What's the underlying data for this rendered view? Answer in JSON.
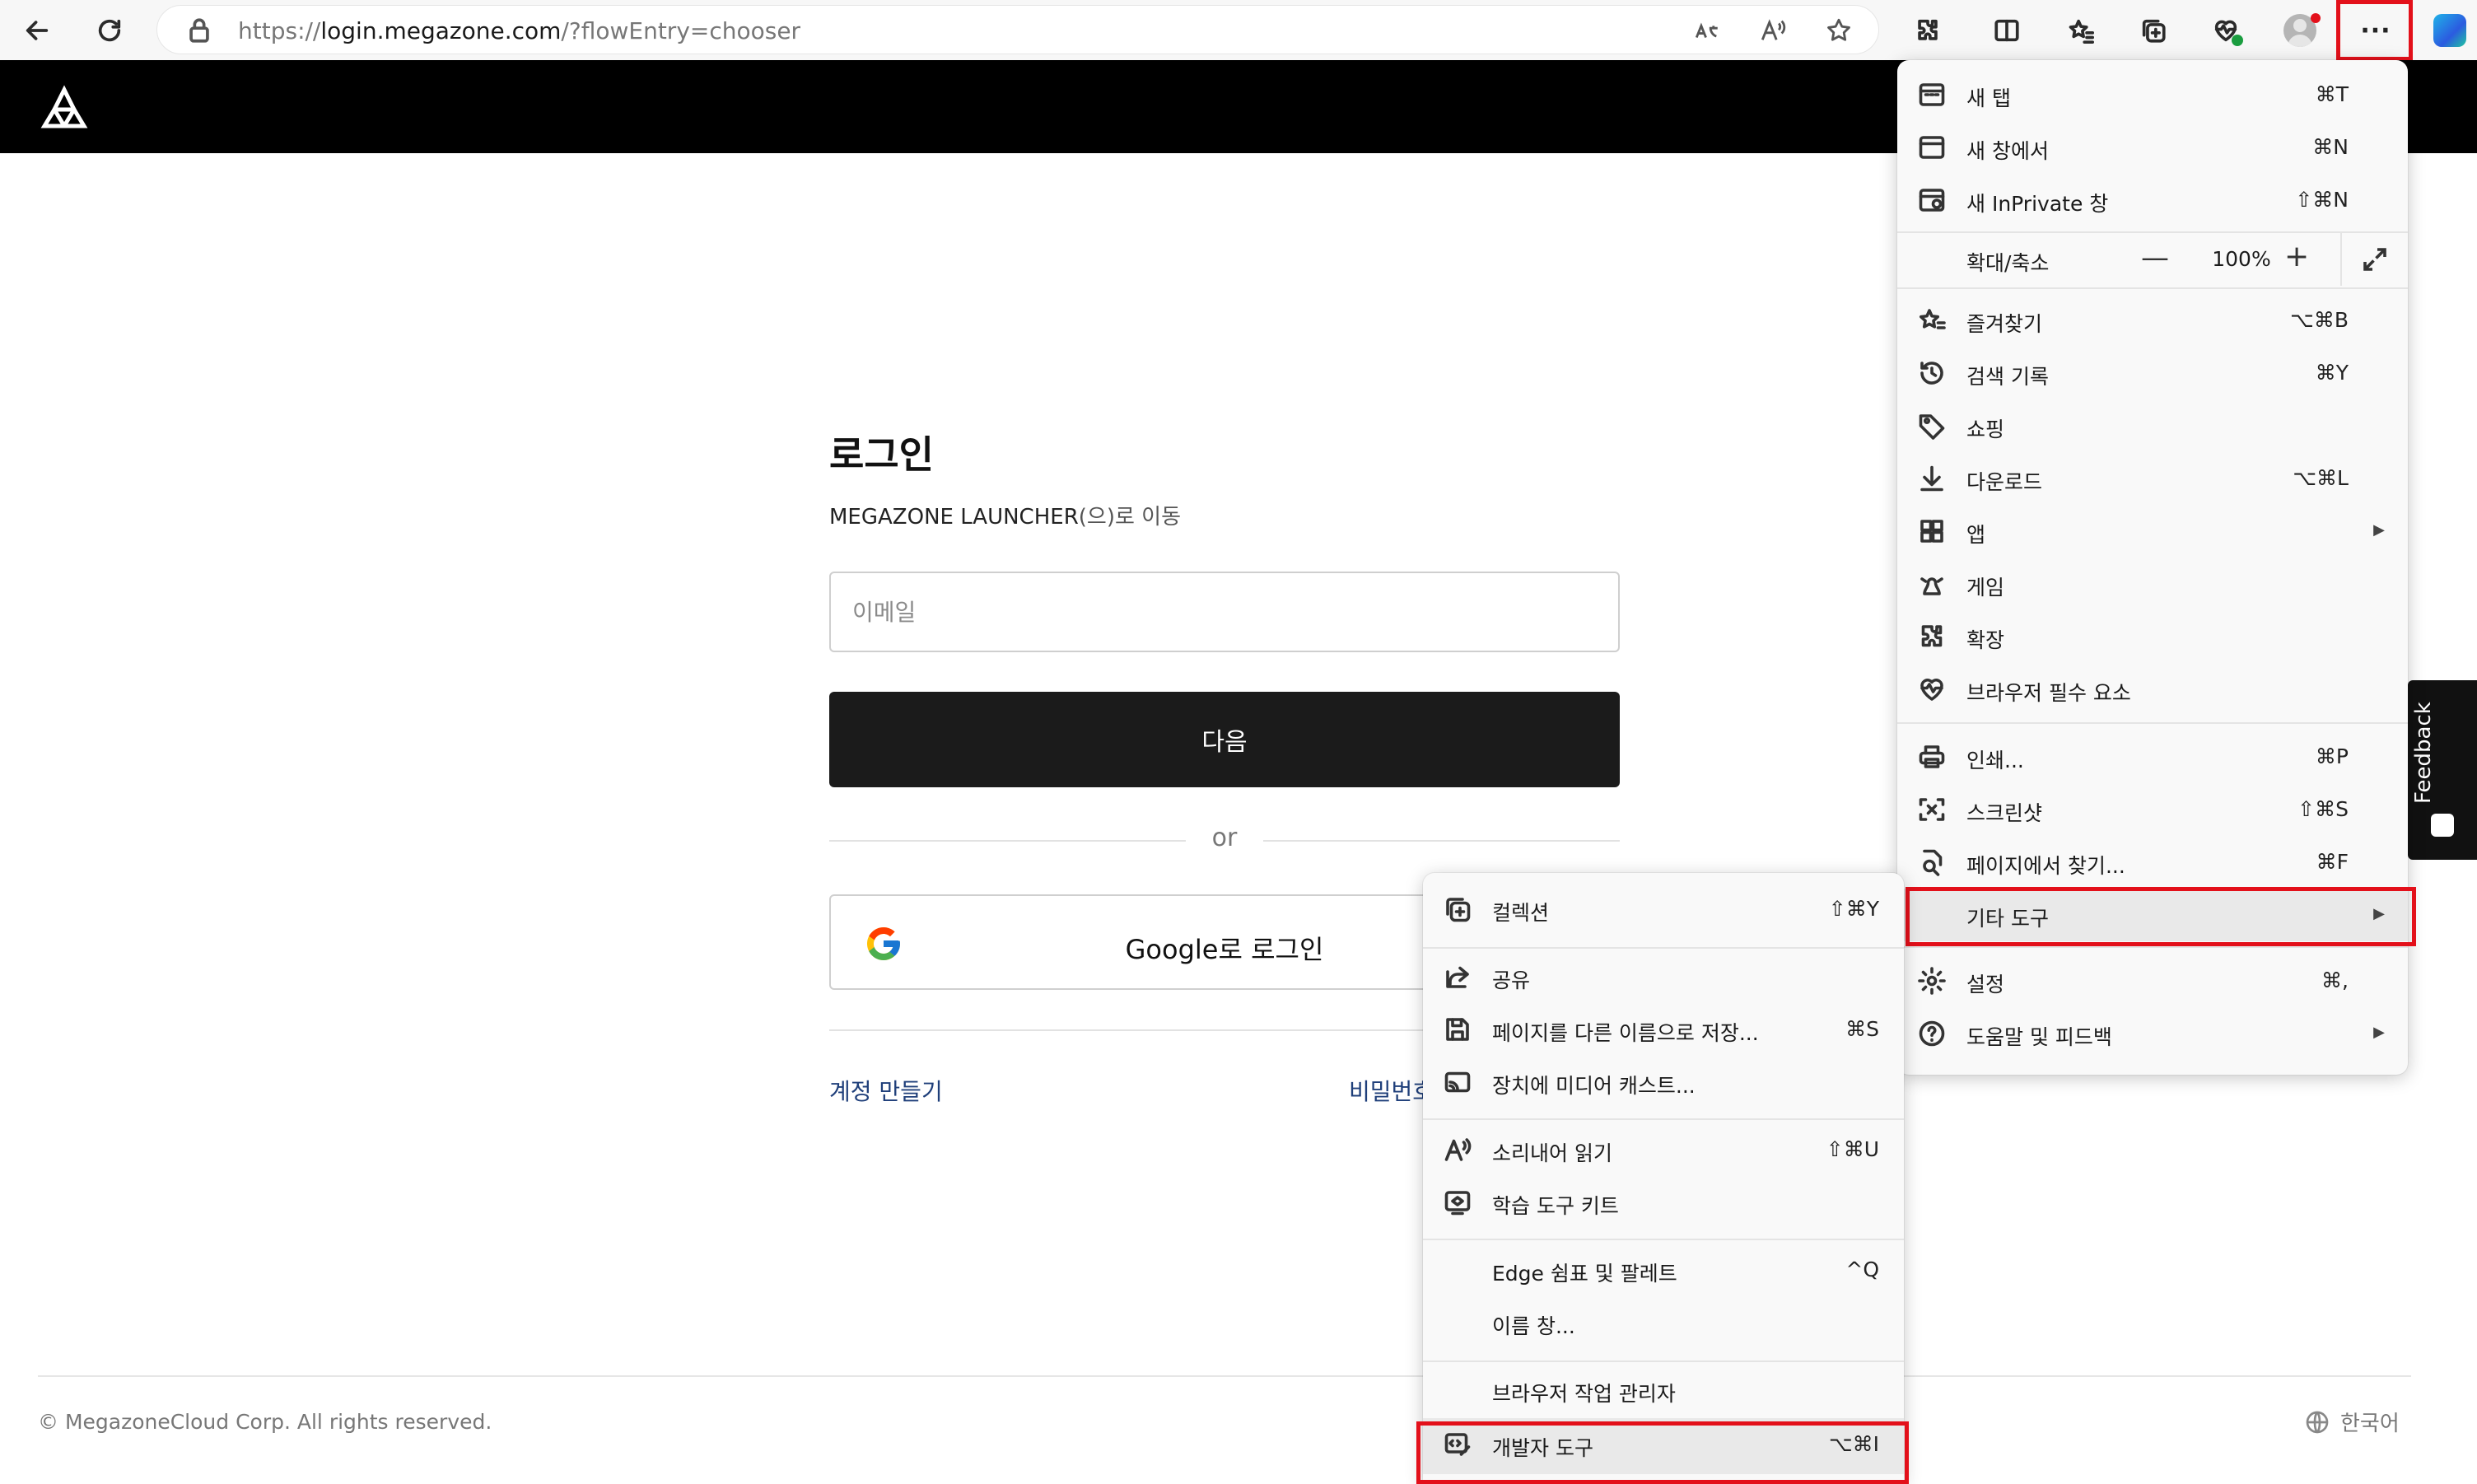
{
  "browser": {
    "url_prefix": "https://",
    "url_domain": "login.megazone.com",
    "url_path": "/?flowEntry=chooser",
    "more_glyph": "···"
  },
  "page": {
    "title": "로그인",
    "subtitle_app": "MEGAZONE LAUNCHER",
    "subtitle_move": "(으)로 이동",
    "email_placeholder": "이메일",
    "next_button": "다음",
    "or_text": "or",
    "google_button": "Google로 로그인",
    "create_account": "계정 만들기",
    "forgot_password": "비밀번호",
    "copyright": "© MegazoneCloud Corp. All rights reserved.",
    "language": "한국어",
    "feedback": "Feedback"
  },
  "main_menu": {
    "items": [
      {
        "label": "새 탭",
        "shortcut": "⌘T"
      },
      {
        "label": "새 창에서",
        "shortcut": "⌘N"
      },
      {
        "label": "새 InPrivate 창",
        "shortcut": "⇧⌘N"
      }
    ],
    "zoom": {
      "label": "확대/축소",
      "minus": "—",
      "value": "100%",
      "plus": "+"
    },
    "items2": [
      {
        "label": "즐겨찾기",
        "shortcut": "⌥⌘B"
      },
      {
        "label": "검색 기록",
        "shortcut": "⌘Y"
      },
      {
        "label": "쇼핑",
        "shortcut": ""
      },
      {
        "label": "다운로드",
        "shortcut": "⌥⌘L"
      },
      {
        "label": "앱",
        "shortcut": ""
      },
      {
        "label": "게임",
        "shortcut": ""
      },
      {
        "label": "확장",
        "shortcut": ""
      },
      {
        "label": "브라우저 필수 요소",
        "shortcut": ""
      }
    ],
    "items3": [
      {
        "label": "인쇄...",
        "shortcut": "⌘P"
      },
      {
        "label": "스크린샷",
        "shortcut": "⇧⌘S"
      },
      {
        "label": "페이지에서 찾기...",
        "shortcut": "⌘F"
      },
      {
        "label": "기타 도구",
        "shortcut": ""
      }
    ],
    "items4": [
      {
        "label": "설정",
        "shortcut": "⌘,"
      },
      {
        "label": "도움말 및 피드백",
        "shortcut": ""
      }
    ]
  },
  "submenu": {
    "items": [
      {
        "label": "컬렉션",
        "shortcut": "⇧⌘Y"
      },
      {
        "label": "공유",
        "shortcut": ""
      },
      {
        "label": "페이지를 다른 이름으로 저장...",
        "shortcut": "⌘S"
      },
      {
        "label": "장치에 미디어 캐스트...",
        "shortcut": ""
      },
      {
        "label": "소리내어 읽기",
        "shortcut": "⇧⌘U"
      },
      {
        "label": "학습 도구 키트",
        "shortcut": ""
      },
      {
        "label": "Edge 쉼표 및 팔레트",
        "shortcut": "^Q"
      },
      {
        "label": "이름 창...",
        "shortcut": ""
      },
      {
        "label": "브라우저 작업 관리자",
        "shortcut": ""
      },
      {
        "label": "개발자 도구",
        "shortcut": "⌥⌘I"
      }
    ]
  },
  "colors": {
    "highlight_border": "#e3101a",
    "header_bg": "#000000",
    "button_bg": "#1b1b1b",
    "link": "#1f3f7a"
  }
}
